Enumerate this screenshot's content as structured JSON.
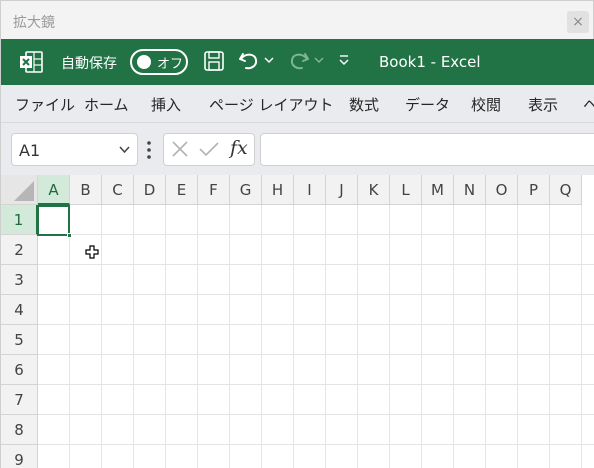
{
  "magnifier": {
    "title": "拡大鏡",
    "close_label": "×"
  },
  "excel": {
    "autosave_label": "自動保存",
    "autosave_state": "オフ",
    "document_title": "Book1  -  Excel",
    "brand_color": "#217346"
  },
  "ribbon": {
    "tabs": [
      {
        "label": "ファイル"
      },
      {
        "label": "ホーム"
      },
      {
        "label": "挿入"
      },
      {
        "label": "ページ レイアウト"
      },
      {
        "label": "数式"
      },
      {
        "label": "データ"
      },
      {
        "label": "校閲"
      },
      {
        "label": "表示"
      },
      {
        "label": "ヘ"
      }
    ]
  },
  "formula_bar": {
    "name_box": "A1",
    "fx_label": "fx",
    "value": ""
  },
  "sheet": {
    "columns": [
      "A",
      "B",
      "C",
      "D",
      "E",
      "F",
      "G",
      "H",
      "I",
      "J",
      "K",
      "L",
      "M",
      "N",
      "O",
      "P",
      "Q"
    ],
    "rows": [
      "1",
      "2",
      "3",
      "4",
      "5",
      "6",
      "7",
      "8",
      "9"
    ],
    "active_cell": "A1"
  }
}
